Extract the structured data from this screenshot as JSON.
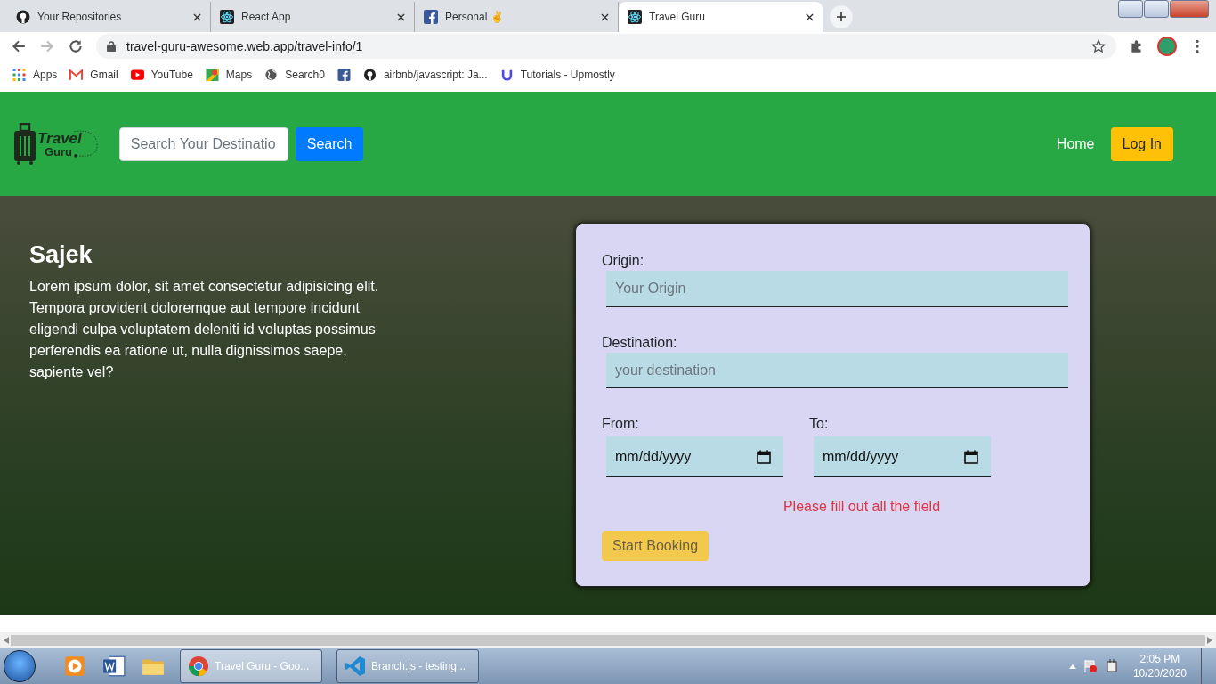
{
  "browser": {
    "tabs": [
      {
        "title": "Your Repositories",
        "kind": "github",
        "selected": false
      },
      {
        "title": "React App",
        "kind": "react",
        "selected": false
      },
      {
        "title": "Personal ✌",
        "kind": "facebook",
        "selected": false
      },
      {
        "title": "Travel Guru",
        "kind": "react",
        "selected": true
      }
    ],
    "address": "travel-guru-awesome.web.app/travel-info/1",
    "bookmarks": [
      {
        "label": "Apps",
        "kind": "apps"
      },
      {
        "label": "Gmail",
        "kind": "gmail"
      },
      {
        "label": "YouTube",
        "kind": "youtube"
      },
      {
        "label": "Maps",
        "kind": "maps"
      },
      {
        "label": "Search0",
        "kind": "globe"
      },
      {
        "kind": "facebook"
      },
      {
        "label": "airbnb/javascript: Ja...",
        "kind": "github"
      },
      {
        "label": "Tutorials - Upmostly",
        "kind": "upmostly"
      }
    ]
  },
  "header": {
    "logo": {
      "line_1": "Travel",
      "line_2": "Guru"
    },
    "search": {
      "placeholder": "Search Your Destinatio"
    },
    "search_button": "Search",
    "nav_links": [
      "Home"
    ],
    "login_button": "Log In"
  },
  "hero": {
    "title": "Sajek",
    "description": "Lorem ipsum dolor, sit amet consectetur adipisicing elit. Tempora provident doloremque aut tempore incidunt eligendi culpa voluptatem deleniti id voluptas possimus perferendis ea ratione ut, nulla dignissimos saepe, sapiente vel?"
  },
  "booking_form": {
    "origin": {
      "label": "Origin:",
      "placeholder": "Your Origin"
    },
    "destination": {
      "label": "Destination:",
      "placeholder": "your destination"
    },
    "dates": [
      {
        "label": "From:",
        "value": "mm/dd/yyyy"
      },
      {
        "label": "To:",
        "value": "mm/dd/yyyy"
      }
    ],
    "error": "Please fill out all the field",
    "submit_button": "Start Booking"
  },
  "taskbar": {
    "windows": [
      {
        "label": "Travel Guru - Goo...",
        "kind": "chrome",
        "selected": true
      },
      {
        "label": "Branch.js - testing...",
        "kind": "vscode",
        "selected": false
      }
    ],
    "time": "2:05 PM",
    "date": "10/20/2020"
  }
}
